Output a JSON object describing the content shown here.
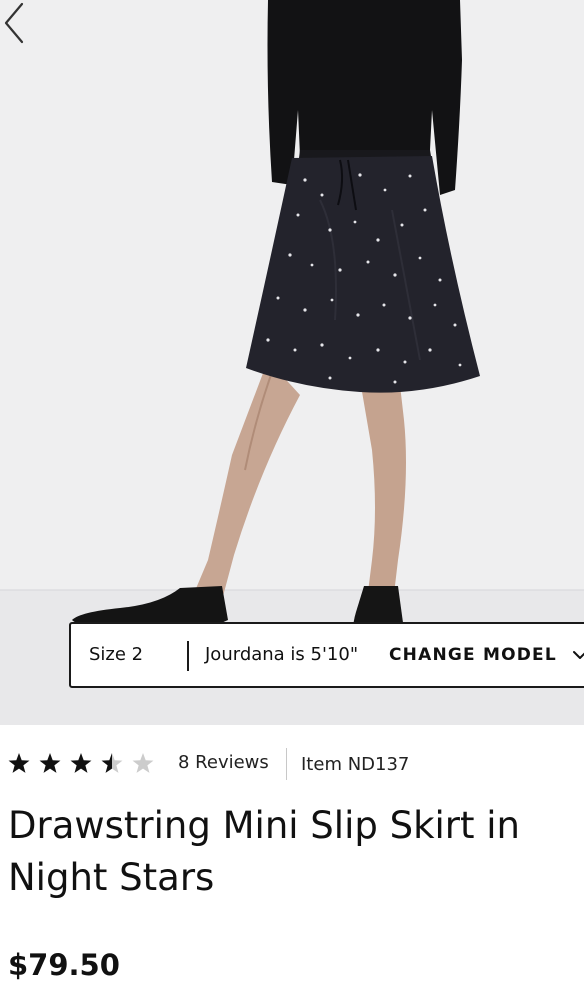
{
  "model_bar": {
    "size": "Size 2",
    "model_info": "Jourdana is 5'10\"",
    "change_label": "CHANGE MODEL"
  },
  "product": {
    "rating": 3.5,
    "rating_max": 5,
    "reviews": "8 Reviews",
    "item_number": "Item ND137",
    "title_line1": "Drawstring Mini Slip Skirt in",
    "title_line2": "Night Stars",
    "price": "$79.50"
  },
  "icons": {
    "prev": "chevron-left-icon",
    "change_model": "chevron-down-icon",
    "rating": "star-icon"
  },
  "colors": {
    "star_filled": "#111111",
    "star_empty": "#cccccc",
    "skirt": "#23232c",
    "background": "#eeeeef"
  }
}
